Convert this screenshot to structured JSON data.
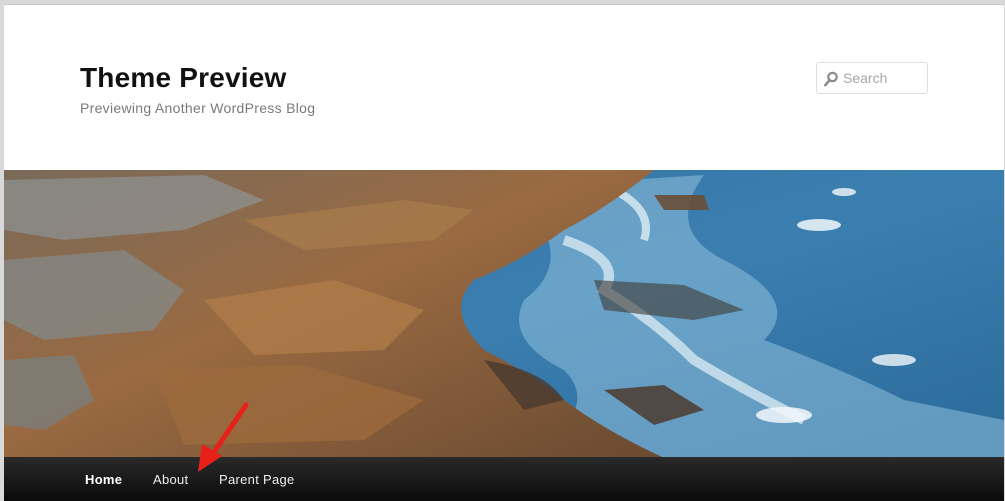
{
  "site": {
    "title": "Theme Preview",
    "description": "Previewing Another WordPress Blog"
  },
  "search": {
    "placeholder": "Search",
    "icon": "search-icon"
  },
  "header_image": {
    "subject": "rocky coastline with ocean waves"
  },
  "menu": {
    "items": [
      {
        "label": "Home",
        "current": true
      },
      {
        "label": "About",
        "current": false
      },
      {
        "label": "Parent Page",
        "current": false
      }
    ]
  },
  "annotation": {
    "arrow_color": "#e8201a"
  },
  "colors": {
    "menu_bar": "#1a1a1a",
    "title": "#111111",
    "tagline": "#7a7a7a"
  }
}
